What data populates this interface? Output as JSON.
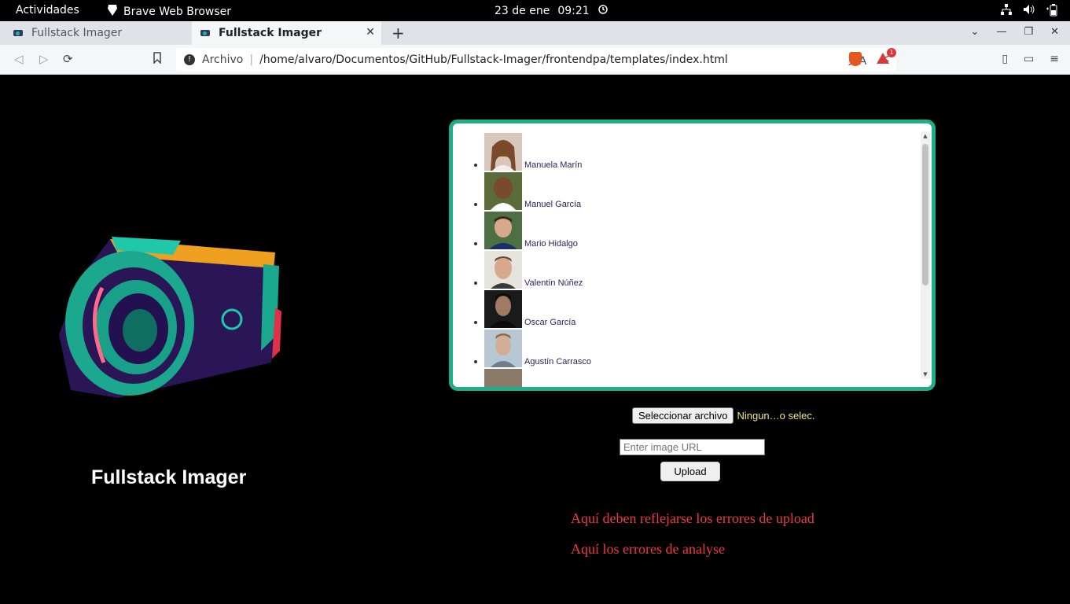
{
  "system_bar": {
    "activities": "Actividades",
    "app_name": "Brave Web Browser",
    "date": "23 de ene",
    "time": "09:21"
  },
  "tabs": [
    {
      "label": "Fullstack Imager",
      "active": false
    },
    {
      "label": "Fullstack Imager",
      "active": true
    }
  ],
  "address_bar": {
    "scheme_label": "Archivo",
    "url": "/home/alvaro/Documentos/GitHub/Fullstack-Imager/frontendpa/templates/index.html",
    "rewards_badge": "1"
  },
  "page": {
    "brand_title": "Fullstack Imager",
    "gallery": [
      {
        "name": "Manuela Marín",
        "thumb_color": "#c9b3a6"
      },
      {
        "name": "Manuel García",
        "thumb_color": "#6b4a34"
      },
      {
        "name": "Mario Hidalgo",
        "thumb_color": "#3e5b3a"
      },
      {
        "name": "Valentín Núñez",
        "thumb_color": "#9a8a80"
      },
      {
        "name": "Oscar García",
        "thumb_color": "#222222"
      },
      {
        "name": "Agustín Carrasco",
        "thumb_color": "#8aa1b5"
      }
    ],
    "file_button": "Seleccionar archivo",
    "file_status": "Ningun…o selec.",
    "url_placeholder": "Enter image URL",
    "upload_button": "Upload",
    "upload_error": "Aquí deben reflejarse los errores de upload",
    "analyse_error": "Aquí los errores de analyse"
  },
  "colors": {
    "accent": "#1fae8a",
    "error": "#ee3a44",
    "file_status": "#f2e98a"
  }
}
